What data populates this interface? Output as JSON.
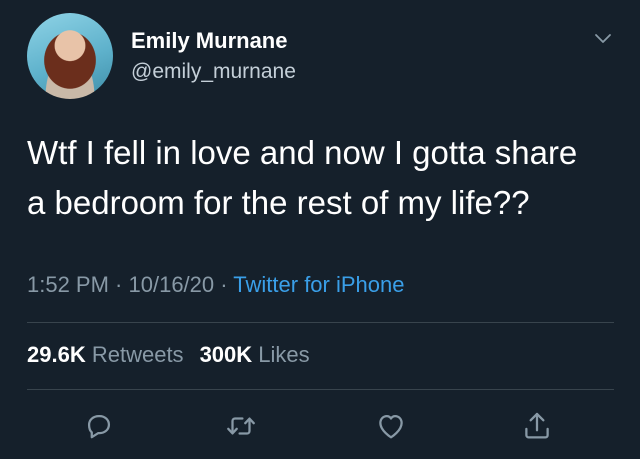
{
  "author": {
    "name": "Emily Murnane",
    "handle": "@emily_murnane"
  },
  "tweet": {
    "line1": "Wtf I fell in love and now I gotta share",
    "line2": "a bedroom for the rest of my life??"
  },
  "meta": {
    "time": "1:52 PM",
    "date": "10/16/20",
    "separator": " · ",
    "source": "Twitter for iPhone"
  },
  "stats": {
    "retweets_count": "29.6K",
    "retweets_label": "Retweets",
    "likes_count": "300K",
    "likes_label": "Likes"
  },
  "actions": [
    "reply-icon",
    "retweet-icon",
    "like-icon",
    "share-icon"
  ],
  "colors": {
    "background": "#15202b",
    "secondary_text": "#8899a6",
    "link": "#3a9fe8",
    "divider": "#38444d"
  }
}
